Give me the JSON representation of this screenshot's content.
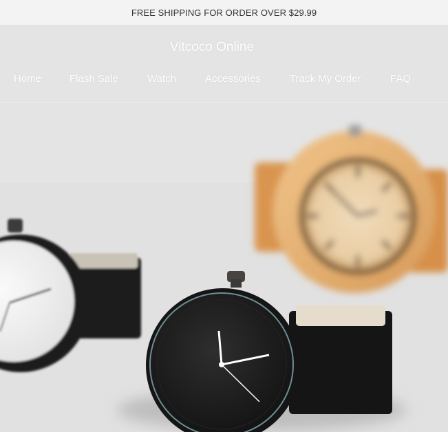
{
  "announcement": {
    "text": "FREE SHIPPING FOR ORDER OVER $29.99"
  },
  "header": {
    "brand": "Vitcoco Online",
    "nav": [
      {
        "label": "Home"
      },
      {
        "label": "Flash Sale"
      },
      {
        "label": "Watch"
      },
      {
        "label": "Accessories"
      },
      {
        "label": "Track My Order"
      },
      {
        "label": "FAQ"
      }
    ]
  },
  "hero": {
    "image": "wrist-watches-photo",
    "colors": {
      "background": "#e4e4e4",
      "wood": "#e0a866",
      "black_watch": "#1d1d1d",
      "white_dial": "#f4f4f4"
    }
  }
}
